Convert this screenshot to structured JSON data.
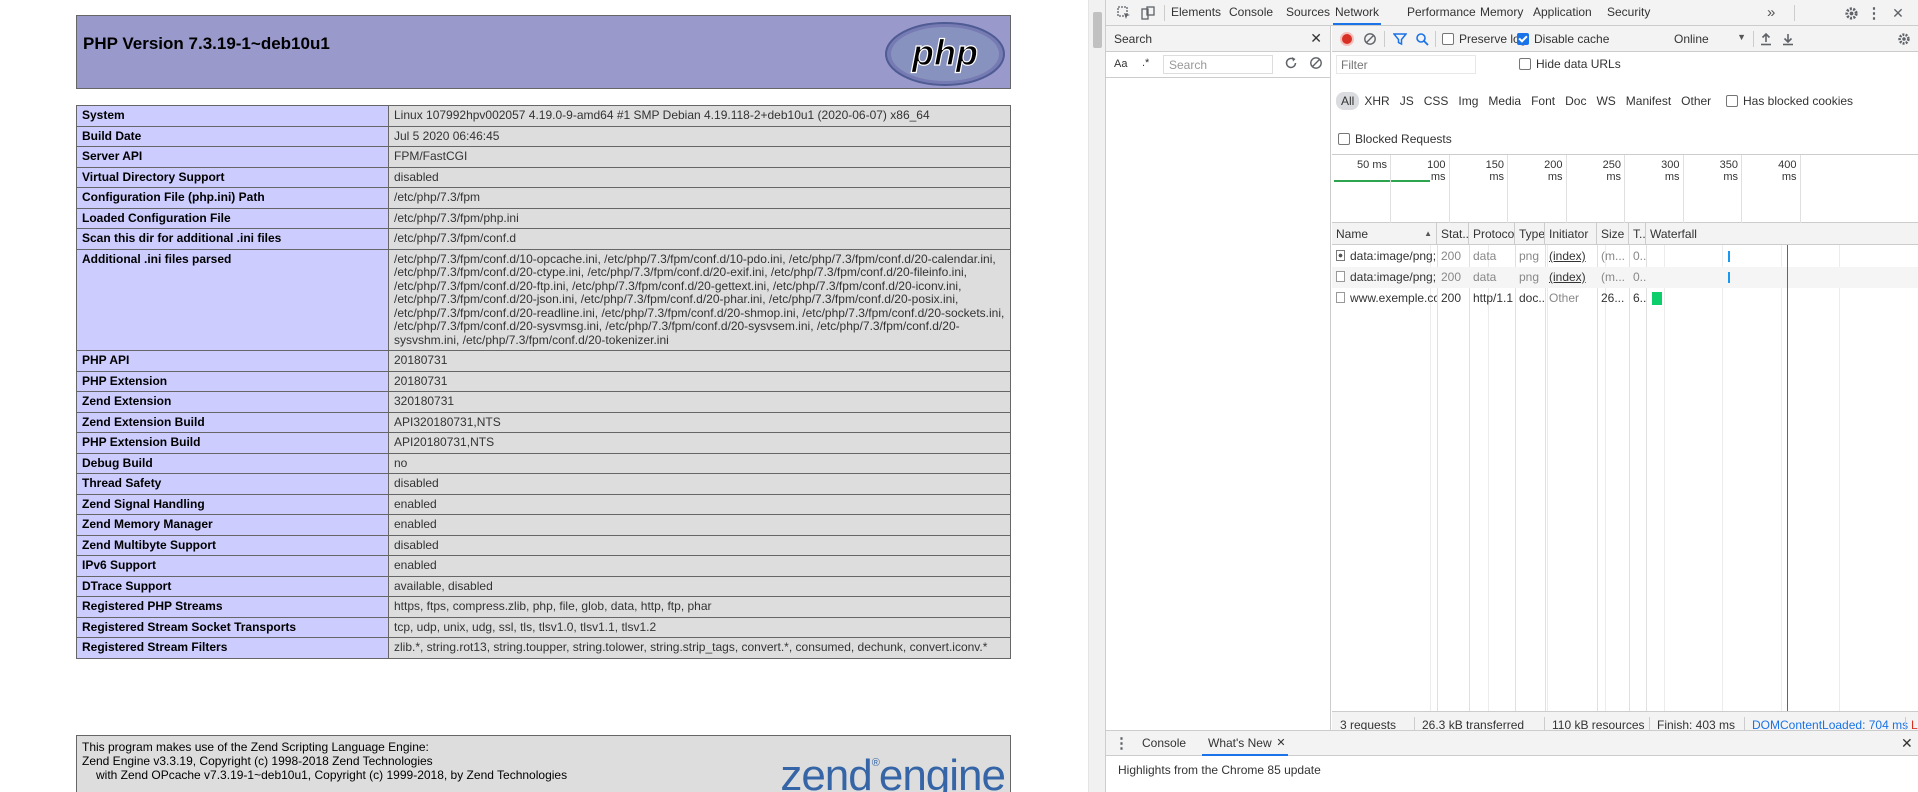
{
  "php": {
    "title": "PHP Version 7.3.19-1~deb10u1",
    "logo_text": "php",
    "rows": [
      {
        "key": "System",
        "value": "Linux 107992hpv002057 4.19.0-9-amd64 #1 SMP Debian 4.19.118-2+deb10u1 (2020-06-07) x86_64"
      },
      {
        "key": "Build Date",
        "value": "Jul 5 2020 06:46:45"
      },
      {
        "key": "Server API",
        "value": "FPM/FastCGI"
      },
      {
        "key": "Virtual Directory Support",
        "value": "disabled"
      },
      {
        "key": "Configuration File (php.ini) Path",
        "value": "/etc/php/7.3/fpm"
      },
      {
        "key": "Loaded Configuration File",
        "value": "/etc/php/7.3/fpm/php.ini"
      },
      {
        "key": "Scan this dir for additional .ini files",
        "value": "/etc/php/7.3/fpm/conf.d"
      },
      {
        "key": "Additional .ini files parsed",
        "value": "/etc/php/7.3/fpm/conf.d/10-opcache.ini, /etc/php/7.3/fpm/conf.d/10-pdo.ini, /etc/php/7.3/fpm/conf.d/20-calendar.ini, /etc/php/7.3/fpm/conf.d/20-ctype.ini, /etc/php/7.3/fpm/conf.d/20-exif.ini, /etc/php/7.3/fpm/conf.d/20-fileinfo.ini, /etc/php/7.3/fpm/conf.d/20-ftp.ini, /etc/php/7.3/fpm/conf.d/20-gettext.ini, /etc/php/7.3/fpm/conf.d/20-iconv.ini, /etc/php/7.3/fpm/conf.d/20-json.ini, /etc/php/7.3/fpm/conf.d/20-phar.ini, /etc/php/7.3/fpm/conf.d/20-posix.ini, /etc/php/7.3/fpm/conf.d/20-readline.ini, /etc/php/7.3/fpm/conf.d/20-shmop.ini, /etc/php/7.3/fpm/conf.d/20-sockets.ini, /etc/php/7.3/fpm/conf.d/20-sysvmsg.ini, /etc/php/7.3/fpm/conf.d/20-sysvsem.ini, /etc/php/7.3/fpm/conf.d/20-sysvshm.ini, /etc/php/7.3/fpm/conf.d/20-tokenizer.ini"
      },
      {
        "key": "PHP API",
        "value": "20180731"
      },
      {
        "key": "PHP Extension",
        "value": "20180731"
      },
      {
        "key": "Zend Extension",
        "value": "320180731"
      },
      {
        "key": "Zend Extension Build",
        "value": "API320180731,NTS"
      },
      {
        "key": "PHP Extension Build",
        "value": "API20180731,NTS"
      },
      {
        "key": "Debug Build",
        "value": "no"
      },
      {
        "key": "Thread Safety",
        "value": "disabled"
      },
      {
        "key": "Zend Signal Handling",
        "value": "enabled"
      },
      {
        "key": "Zend Memory Manager",
        "value": "enabled"
      },
      {
        "key": "Zend Multibyte Support",
        "value": "disabled"
      },
      {
        "key": "IPv6 Support",
        "value": "enabled"
      },
      {
        "key": "DTrace Support",
        "value": "available, disabled"
      },
      {
        "key": "Registered PHP Streams",
        "value": "https, ftps, compress.zlib, php, file, glob, data, http, ftp, phar"
      },
      {
        "key": "Registered Stream Socket Transports",
        "value": "tcp, udp, unix, udg, ssl, tls, tlsv1.0, tlsv1.1, tlsv1.2"
      },
      {
        "key": "Registered Stream Filters",
        "value": "zlib.*, string.rot13, string.toupper, string.tolower, string.strip_tags, convert.*, consumed, dechunk, convert.iconv.*"
      }
    ],
    "zend": {
      "line1": "This program makes use of the Zend Scripting Language Engine:",
      "line2": "Zend Engine v3.3.19, Copyright (c) 1998-2018 Zend Technologies",
      "line3": "with Zend OPcache v7.3.19-1~deb10u1, Copyright (c) 1999-2018, by Zend Technologies",
      "logo_word1": "zend",
      "logo_reg": "®",
      "logo_word2": "engine"
    }
  },
  "devtools": {
    "tabs": [
      "Elements",
      "Console",
      "Sources",
      "Network",
      "Performance",
      "Memory",
      "Application",
      "Security"
    ],
    "active_tab": "Network",
    "overflow": "»",
    "search_title": "Search",
    "search_placeholder": "Search",
    "search_aa": "Aa",
    "search_regex": ".*",
    "toolbar": {
      "preserve_log": "Preserve log",
      "disable_cache": "Disable cache",
      "throttle": "Online"
    },
    "filter": {
      "placeholder": "Filter",
      "hide_data_urls": "Hide data URLs",
      "types": [
        "All",
        "XHR",
        "JS",
        "CSS",
        "Img",
        "Media",
        "Font",
        "Doc",
        "WS",
        "Manifest",
        "Other"
      ],
      "has_blocked_cookies": "Has blocked cookies",
      "blocked_requests": "Blocked Requests"
    },
    "timeline_ticks": [
      "50 ms",
      "100 ms",
      "150 ms",
      "200 ms",
      "250 ms",
      "300 ms",
      "350 ms",
      "400 ms"
    ],
    "columns": [
      "Name",
      "Stat...",
      "Protocol",
      "Type",
      "Initiator",
      "Size",
      "T...",
      "Waterfall"
    ],
    "requests": [
      {
        "name": "data:image/png;...",
        "status": "200",
        "protocol": "data",
        "type": "png",
        "initiator": "(index)",
        "size": "(m...",
        "time": "0..."
      },
      {
        "name": "data:image/png;...",
        "status": "200",
        "protocol": "data",
        "type": "png",
        "initiator": "(index)",
        "size": "(m...",
        "time": "0..."
      },
      {
        "name": "www.exemple.com",
        "status": "200",
        "protocol": "http/1.1",
        "type": "doc...",
        "initiator": "Other",
        "size": "26...",
        "time": "6..."
      }
    ],
    "status": {
      "requests": "3 requests",
      "transferred": "26.3 kB transferred",
      "resources": "110 kB resources",
      "finish": "Finish: 403 ms",
      "dom": "DOMContentLoaded: 704 ms",
      "load": "Lo"
    },
    "drawer": {
      "tabs": [
        "Console",
        "What's New"
      ],
      "content": "Highlights from the Chrome 85 update"
    },
    "colors": {
      "accent": "#1a73e8",
      "record": "#d93025",
      "php_header": "#9999cc",
      "php_key": "#ccccff",
      "php_value": "#dddddd",
      "waterfall_green": "#0cce6b",
      "waterfall_blue": "#1a98f0"
    }
  }
}
